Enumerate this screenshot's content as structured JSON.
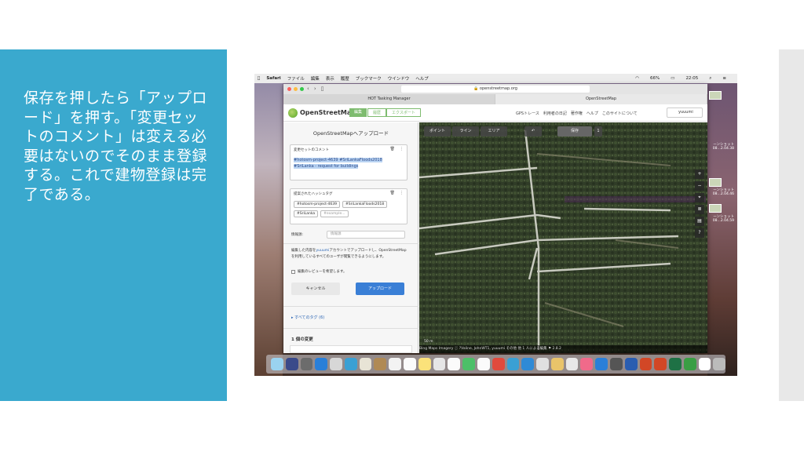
{
  "slide": {
    "caption": "保存を押したら「アップロード」を押す。「変更セットのコメント」は変える必要はないのでそのまま登録する。これで建物登録は完了である。",
    "accent_color": "#3aa9ce"
  },
  "menubar": {
    "items": [
      "Safari",
      "ファイル",
      "編集",
      "表示",
      "履歴",
      "ブックマーク",
      "ウインドウ",
      "ヘルプ"
    ],
    "battery": "66%",
    "time": "22:05"
  },
  "browser": {
    "url": "openstreetmap.org",
    "tabs": [
      "HOT Tasking Manager",
      "OpenStreetMap"
    ]
  },
  "osm": {
    "brand": "OpenStreetMap",
    "nav": [
      "編集",
      "履歴",
      "エクスポート"
    ],
    "right_nav": [
      "GPSトレース",
      "利用者の日記",
      "著作権",
      "ヘルプ",
      "このサイトについて"
    ],
    "user": "yuuumi"
  },
  "upload": {
    "title": "OpenStreetMapへアップロード",
    "comment_label": "変更セットのコメント",
    "comment": "#hotosm-project-4639 #SriLankaFloods2018 #SriLanka - request for buildings",
    "hashtags_label": "提案されたハッシュタグ",
    "hashtags": [
      "#hotosm-project-4639",
      "#SriLankaFloods2018",
      "#SriLanka"
    ],
    "hashtag_placeholder": "#example...",
    "source_label": "情報源:",
    "source_placeholder": "情報源",
    "info_pre": "編集した内容を",
    "info_link": "yuuumi",
    "info_post": "アカウントでアップロードし、OpenStreetMapを利用しているすべてのユーザが閲覧できるようにします。",
    "review_label": "編集のレビューを希望します。",
    "cancel": "キャンセル",
    "submit": "アップロード",
    "tags_link": "▸ すべてのタグ (6)",
    "changes_title": "1 個の変更"
  },
  "map": {
    "tools": [
      "ポイント",
      "ライン",
      "エリア"
    ],
    "save": "保存",
    "save_count": "1",
    "scale": "50 m",
    "footer": "Bing Maps Imagery   ⓘ   ?Valine, JohnWT1, yuuumi その他 他 1 人による編集   ⚑   2.8.2",
    "right_tools": [
      "+",
      "−",
      "⌖",
      "≣",
      "▤",
      "?"
    ]
  },
  "desktop": {
    "items": [
      {
        "label": "ーンショット 08...2.04.38"
      },
      {
        "label": "ーンショット 08...2.04.46"
      },
      {
        "label": "ーンショット 08...2.04.59"
      }
    ]
  },
  "dock": {
    "colors": [
      "#9ad3f0",
      "#3a4a8a",
      "#6c6c6c",
      "#2a7fd8",
      "#d7d7d7",
      "#3aa0d4",
      "#e8e4d6",
      "#b08a55",
      "#f3f3f3",
      "#fbfbfb",
      "#fbe27a",
      "#e6e6e6",
      "#fbfbfb",
      "#4cbf68",
      "#fbfbfb",
      "#e14a3c",
      "#3aa0d4",
      "#2e8ad6",
      "#e0e0e0",
      "#e9c46a",
      "#e8e8e8",
      "#f06a8a",
      "#2a7fd8",
      "#555555",
      "#2a5db0",
      "#d24726",
      "#d24726",
      "#1e7145",
      "#3a9e44",
      "#ffffff",
      "#bbbbbb"
    ]
  }
}
